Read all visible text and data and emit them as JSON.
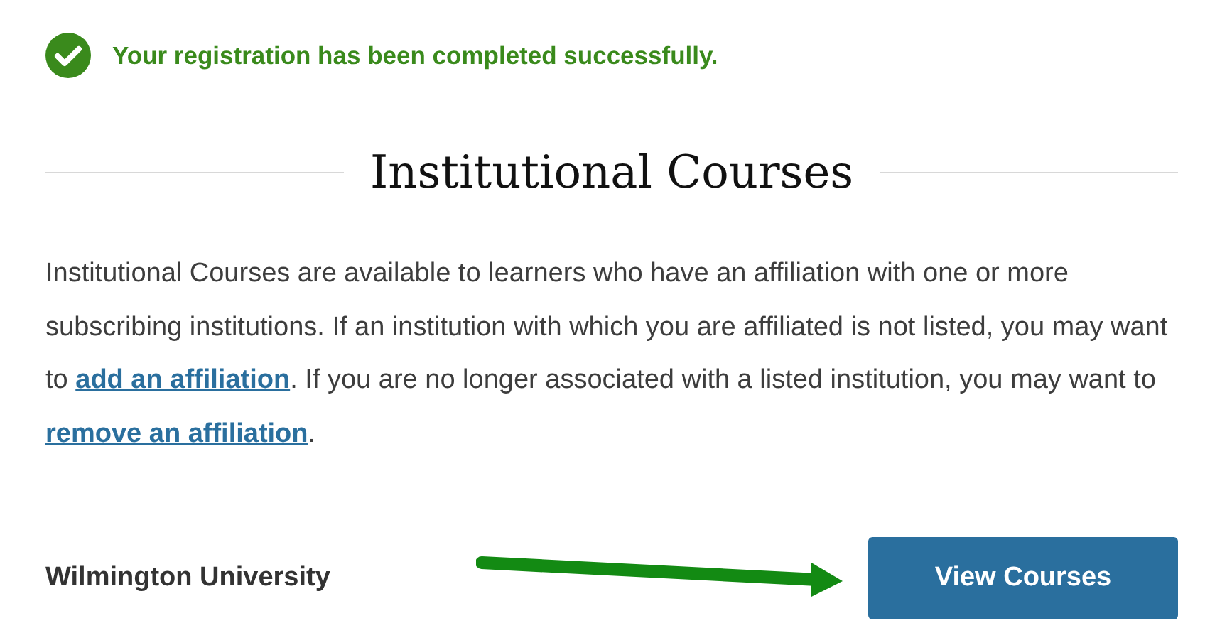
{
  "alert": {
    "kind": "success",
    "text": "Your registration has been completed successfully."
  },
  "heading": "Institutional Courses",
  "description": [
    {
      "kind": "text",
      "text": "Institutional Courses are available to learners who have an affiliation with one or more subscribing institutions. If an institution with which you are affiliated is not listed, you may want to "
    },
    {
      "kind": "link",
      "text": "add an affiliation"
    },
    {
      "kind": "text",
      "text": ". If you are no longer associated with a listed institution, you may want to "
    },
    {
      "kind": "link",
      "text": "remove an affiliation"
    },
    {
      "kind": "text",
      "text": "."
    }
  ],
  "institution": {
    "name": "Wilmington University",
    "button": "View Courses"
  }
}
